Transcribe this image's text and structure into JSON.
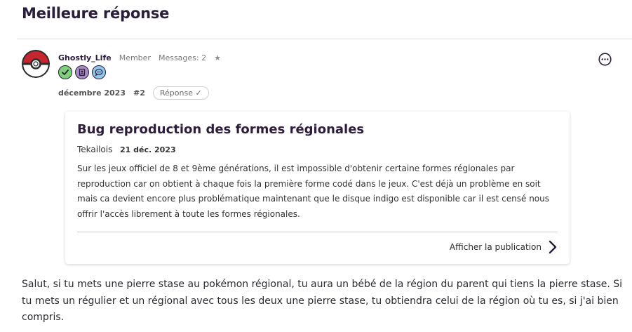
{
  "section_title": "Meilleure réponse",
  "post": {
    "username": "Ghostly_Life",
    "role": "Member",
    "messages": "Messages: 2",
    "star": "★",
    "date": "décembre 2023",
    "post_number": "#2",
    "answer_label": "Réponse ✓",
    "badges": [
      "check-badge-icon",
      "photo-badge-icon",
      "chat-badge-icon"
    ],
    "body": "Salut, si tu mets une pierre stase au pokémon régional, tu aura un bébé de la région du parent qui tiens la pierre stase. Si tu mets un régulier et un régional avec tous les deux une pierre stase, tu obtiendra celui de la région où tu es, si j'ai bien compris."
  },
  "quoted": {
    "title": "Bug reproduction des formes régionales",
    "author": "Tekailois",
    "date": "21 déc. 2023",
    "body": "Sur les jeux officiel de 8 et 9ème générations, il est impossible d'obtenir certaine formes régionales par reproduction car on obtient à chaque fois la première forme codé dans le jeux. C'est déjà un problème en soit mais ca devient encore plus problématique maintenant que le disque indigo est disponible car il est censé nous offrir l'accès librement à toute les formes régionales.",
    "link_label": "Afficher la publication"
  },
  "colors": {
    "heading": "#2c1d3d",
    "pokeball_red": "#c8262e",
    "badge_green": "#7ed07a",
    "badge_purple": "#a88cc4",
    "badge_blue": "#8ec7ea"
  }
}
